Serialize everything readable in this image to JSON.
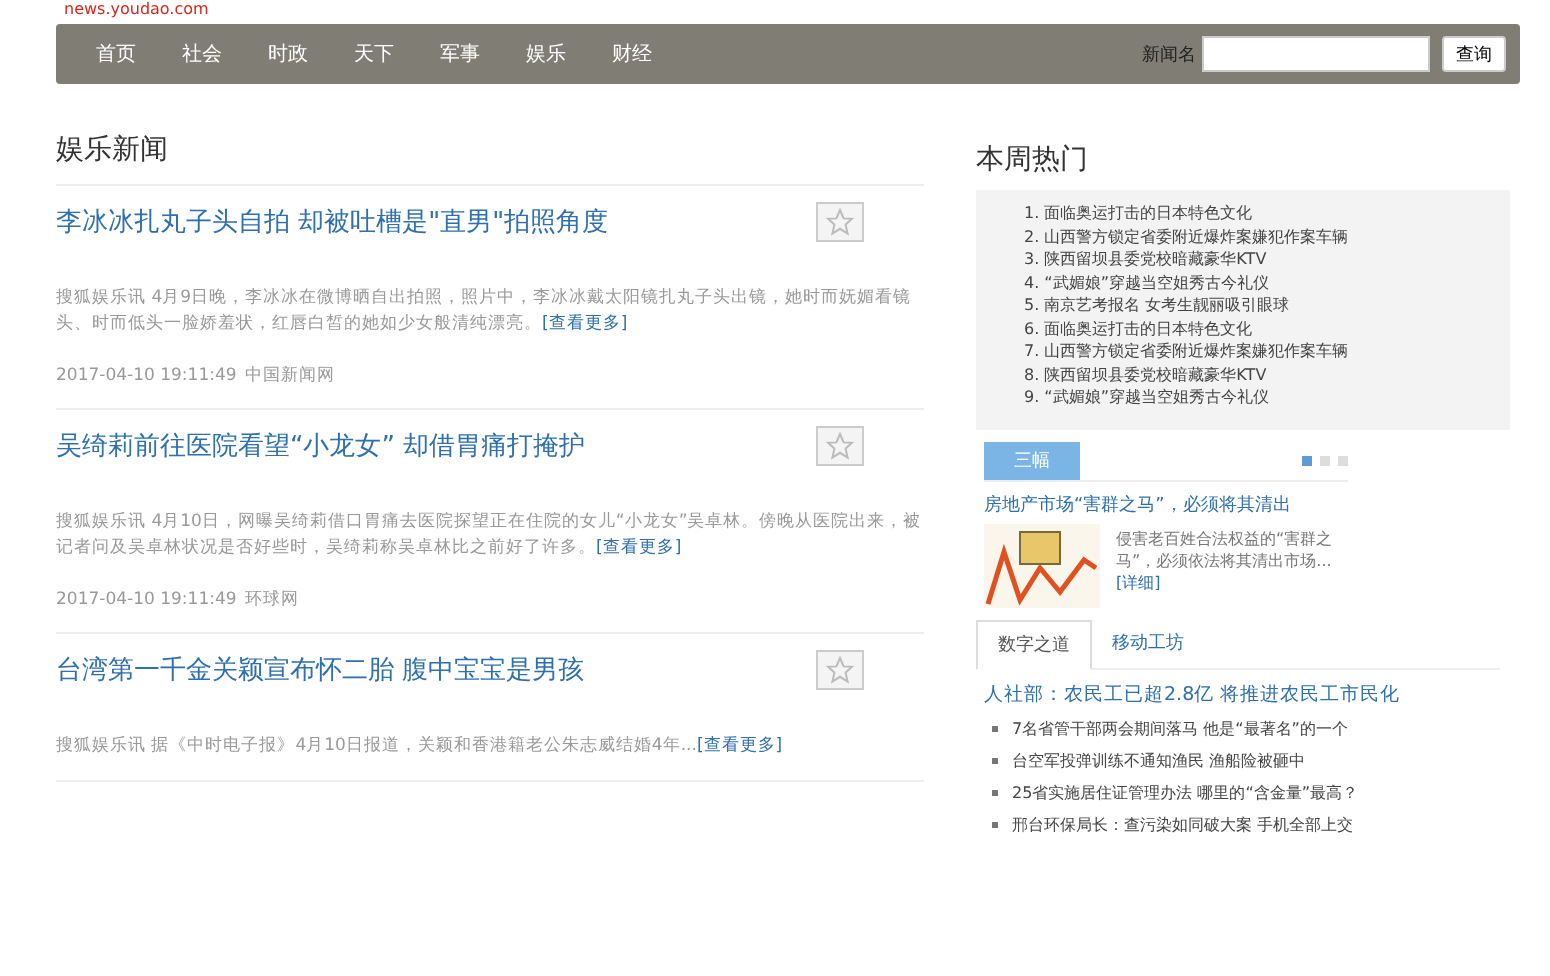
{
  "top_url": "news.youdao.com",
  "nav": {
    "items": [
      {
        "label": "首页"
      },
      {
        "label": "社会"
      },
      {
        "label": "时政"
      },
      {
        "label": "天下"
      },
      {
        "label": "军事"
      },
      {
        "label": "娱乐"
      },
      {
        "label": "财经"
      }
    ],
    "search_label": "新闻名",
    "search_button": "查询"
  },
  "section_title": "娱乐新闻",
  "articles": [
    {
      "title": "李冰冰扎丸子头自拍 却被吐槽是\"直男\"拍照角度",
      "summary": "搜狐娱乐讯 4月9日晚，李冰冰在微博晒自出拍照，照片中，李冰冰戴太阳镜扎丸子头出镜，她时而妩媚看镜头、时而低头一脸娇羞状，红唇白皙的她如少女般清纯漂亮。",
      "more": "[查看更多]",
      "date": "2017-04-10 19:11:49",
      "source": "中国新闻网"
    },
    {
      "title": "吴绮莉前往医院看望“小龙女” 却借胃痛打掩护",
      "summary": "搜狐娱乐讯 4月10日，网曝吴绮莉借口胃痛去医院探望正在住院的女儿“小龙女”吴卓林。傍晚从医院出来，被记者问及吴卓林状况是否好些时，吴绮莉称吴卓林比之前好了许多。",
      "more": "[查看更多]",
      "date": "2017-04-10 19:11:49",
      "source": "环球网"
    },
    {
      "title": "台湾第一千金关颖宣布怀二胎 腹中宝宝是男孩",
      "summary": "搜狐娱乐讯 据《中时电子报》4月10日报道，关颖和香港籍老公朱志威结婚4年...",
      "more": "[查看更多]"
    }
  ],
  "hot": {
    "title": "本周热门",
    "items": [
      "1. 面临奥运打击的日本特色文化",
      "2. 山西警方锁定省委附近爆炸案嫌犯作案车辆",
      "3. 陕西留坝县委党校暗藏豪华KTV",
      "4. “武媚娘”穿越当空姐秀古今礼仪",
      "5. 南京艺考报名 女考生靓丽吸引眼球",
      "6. 面临奥运打击的日本特色文化",
      "7. 山西警方锁定省委附近爆炸案嫌犯作案车辆",
      "8. 陕西留坝县委党校暗藏豪华KTV",
      "9. “武媚娘”穿越当空姐秀古今礼仪"
    ]
  },
  "carousel": {
    "tab": "三幅",
    "dots": [
      {
        "selected": true
      },
      {
        "selected": false
      },
      {
        "selected": false
      }
    ],
    "headline": "房地产市场“害群之马”，必须将其清出",
    "text": "侵害老百姓合法权益的“害群之马”，必须依法将其清出市场...",
    "link": "[详细]"
  },
  "tabs": [
    {
      "label": "数字之道",
      "selected": true
    },
    {
      "label": "移动工坊",
      "selected": false
    }
  ],
  "feature": {
    "headline": "人社部：农民工已超2.8亿 将推进农民工市民化",
    "items": [
      "7名省管干部两会期间落马 他是“最著名”的一个",
      "台空军投弹训练不通知渔民 渔船险被砸中",
      "25省实施居住证管理办法 哪里的“含金量”最高？",
      "邢台环保局长：查污染如同破大案 手机全部上交"
    ]
  }
}
